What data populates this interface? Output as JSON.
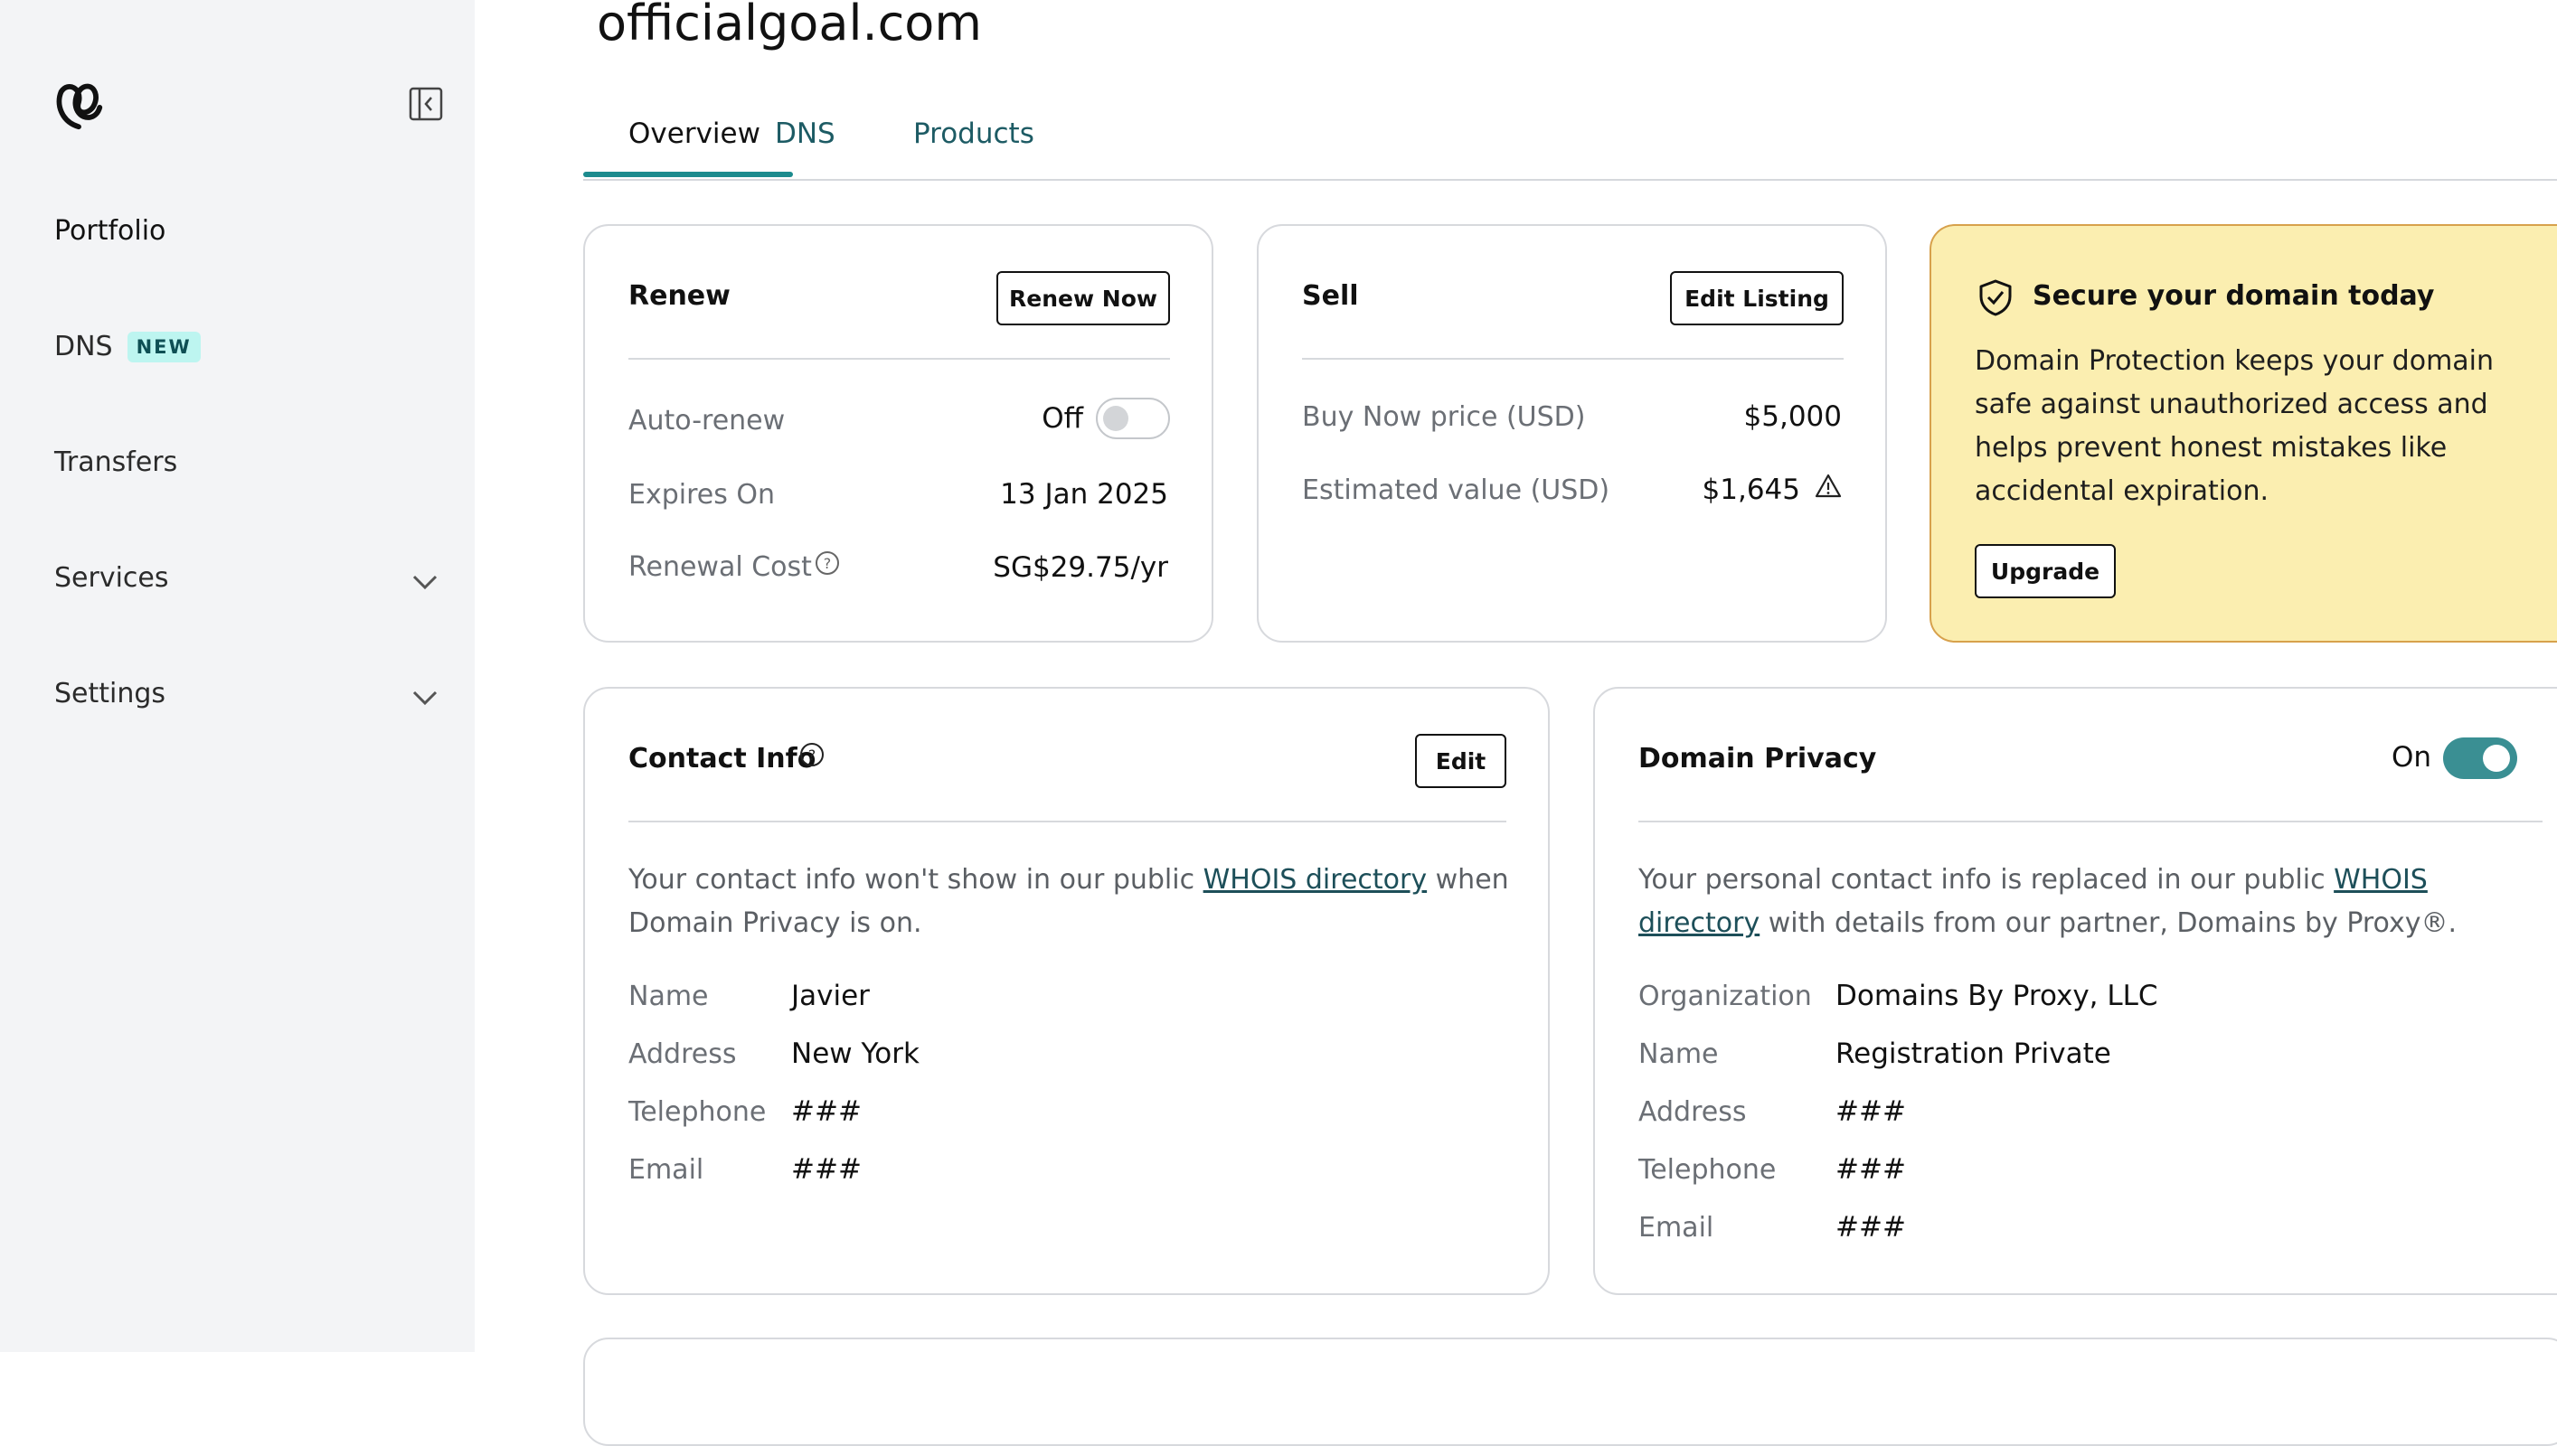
{
  "sidebar": {
    "items": [
      {
        "label": "Portfolio"
      },
      {
        "label": "DNS",
        "badge": "NEW"
      },
      {
        "label": "Transfers"
      },
      {
        "label": "Services"
      },
      {
        "label": "Settings"
      }
    ]
  },
  "header": {
    "domain": "officialgoal.com",
    "tabs": [
      {
        "label": "Overview"
      },
      {
        "label": "DNS"
      },
      {
        "label": "Products"
      }
    ]
  },
  "renew": {
    "title": "Renew",
    "button": "Renew Now",
    "auto_renew_label": "Auto-renew",
    "auto_renew_state": "Off",
    "expires_label": "Expires On",
    "expires_value": "13 Jan 2025",
    "cost_label": "Renewal Cost",
    "cost_value": "SG$29.75/yr"
  },
  "sell": {
    "title": "Sell",
    "button": "Edit Listing",
    "buy_now_label": "Buy Now price (USD)",
    "buy_now_value": "$5,000",
    "estimated_label": "Estimated value (USD)",
    "estimated_value": "$1,645"
  },
  "promo": {
    "title": "Secure your domain today",
    "line1": "Domain Protection keeps your domain",
    "line2": "safe against unauthorized access and",
    "line3": "helps prevent honest mistakes like",
    "line4": "accidental expiration.",
    "button": "Upgrade"
  },
  "contact": {
    "title": "Contact Info",
    "button": "Edit",
    "desc_1": "Your contact info won't show in our public ",
    "desc_link": "WHOIS directory",
    "desc_2": " when",
    "desc_3": "Domain Privacy is on.",
    "fields": [
      {
        "label": "Name",
        "value": "Javier"
      },
      {
        "label": "Address",
        "value": "New York"
      },
      {
        "label": "Telephone",
        "value": "###"
      },
      {
        "label": "Email",
        "value": "###"
      }
    ]
  },
  "privacy": {
    "title": "Domain Privacy",
    "state": "On",
    "desc_1": "Your personal contact info is replaced in our public ",
    "desc_link_1": "WHOIS",
    "desc_link_2": "directory",
    "desc_2": " with details from our partner, Domains by Proxy®.",
    "fields": [
      {
        "label": "Organization",
        "value": "Domains By Proxy, LLC"
      },
      {
        "label": "Name",
        "value": "Registration Private"
      },
      {
        "label": "Address",
        "value": "###"
      },
      {
        "label": "Telephone",
        "value": "###"
      },
      {
        "label": "Email",
        "value": "###"
      }
    ]
  },
  "colors": {
    "sidebar_bg": "#f3f4f6",
    "accent_teal": "#1c8b8e",
    "link": "#1d4f59",
    "badge_bg": "#bdf5f0",
    "promo_bg": "#fbeeb0",
    "promo_border": "#d7a14c",
    "toggle_on": "#3a8f93"
  },
  "icons": [
    "godaddy-logo",
    "sidebar-collapse-icon",
    "chevron-down-icon",
    "help-circle-icon",
    "warning-triangle-icon",
    "shield-check-icon"
  ]
}
